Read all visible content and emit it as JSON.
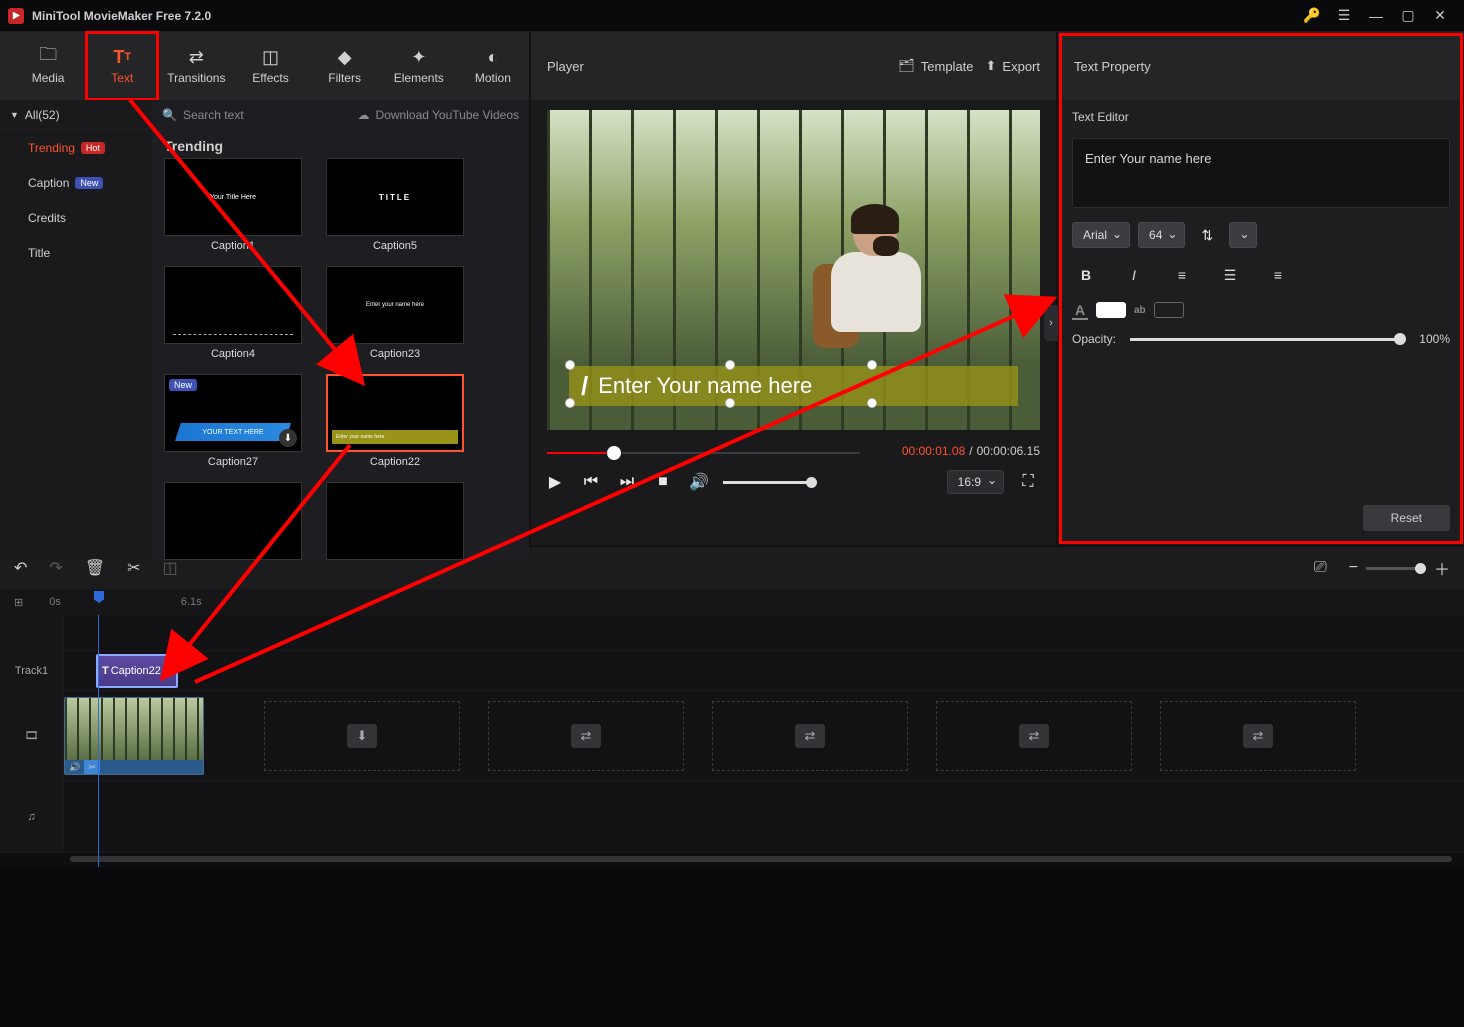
{
  "app": {
    "title": "MiniTool MovieMaker Free 7.2.0"
  },
  "toolbar": {
    "items": [
      {
        "id": "media",
        "label": "Media"
      },
      {
        "id": "text",
        "label": "Text"
      },
      {
        "id": "transitions",
        "label": "Transitions"
      },
      {
        "id": "effects",
        "label": "Effects"
      },
      {
        "id": "filters",
        "label": "Filters"
      },
      {
        "id": "elements",
        "label": "Elements"
      },
      {
        "id": "motion",
        "label": "Motion"
      }
    ],
    "active": "text"
  },
  "browser": {
    "all_label": "All(52)",
    "search_placeholder": "Search text",
    "download_label": "Download YouTube Videos",
    "categories": [
      {
        "label": "Trending",
        "badge": "Hot",
        "active": true
      },
      {
        "label": "Caption",
        "badge": "New"
      },
      {
        "label": "Credits"
      },
      {
        "label": "Title"
      }
    ],
    "group_title": "Trending",
    "items": [
      {
        "label": "Caption1",
        "preview_text": "Your Title Here"
      },
      {
        "label": "Caption5",
        "preview_text": "TITLE"
      },
      {
        "label": "Caption4",
        "preview_text": ""
      },
      {
        "label": "Caption23",
        "preview_text": "Enter your name here"
      },
      {
        "label": "Caption27",
        "preview_text": "YOUR TEXT HERE",
        "badge": "New"
      },
      {
        "label": "Caption22",
        "preview_text": "Enter your name here",
        "selected": true
      }
    ]
  },
  "player": {
    "title": "Player",
    "template_label": "Template",
    "export_label": "Export",
    "caption_current": "Enter Your name here",
    "time_current": "00:00:01.08",
    "time_total": "00:00:06.15",
    "aspect": "16:9"
  },
  "props": {
    "header": "Text Property",
    "editor_label": "Text Editor",
    "text_value": "Enter Your name here",
    "font_family": "Arial",
    "font_size": "64",
    "opacity_label": "Opacity:",
    "opacity_value": "100%",
    "reset_label": "Reset"
  },
  "timeline": {
    "ruler_labels": [
      "0s",
      "6.1s"
    ],
    "track1_label": "Track1",
    "text_clip_label": "Caption22"
  }
}
